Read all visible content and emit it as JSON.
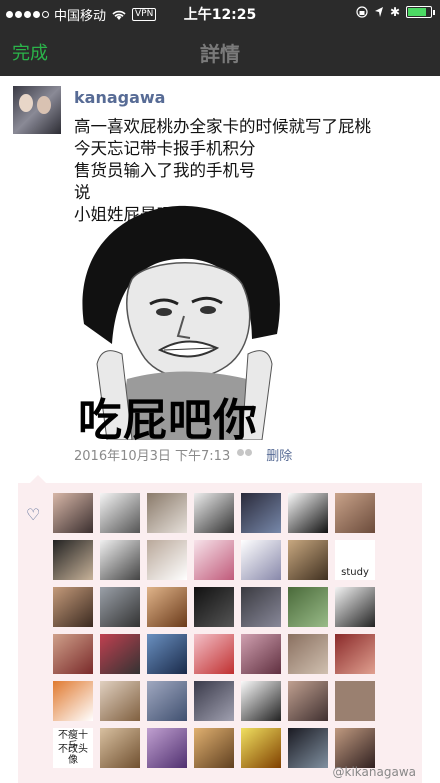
{
  "status_bar": {
    "carrier": "中国移动",
    "vpn": "VPN",
    "time": "上午12:25",
    "battery_level": 0.8
  },
  "nav": {
    "back_label": "完成",
    "title": "詳情"
  },
  "post": {
    "username": "kanagawa",
    "lines": [
      "高一喜欢屁桃办全家卡的时候就写了屁桃",
      "今天忘记带卡报手机积分",
      "售货员输入了我的手机号",
      "说",
      "小姐姓屁是吗"
    ],
    "meme_caption": "吃屁吧你",
    "timestamp": "2016年10月3日  下午7:13",
    "delete_label": "删除"
  },
  "likes": {
    "thumb_texts": {
      "study": "study",
      "t1": "不瘦十斤",
      "t2": "不改头像"
    }
  },
  "watermark": "@kikanagawa",
  "colors": {
    "accent_green": "#2bb44a",
    "link_blue": "#576b95",
    "likes_bg": "#fbeef0"
  },
  "icons": [
    "wifi-icon",
    "location-icon",
    "lock-icon",
    "heart-icon",
    "people-icon"
  ]
}
